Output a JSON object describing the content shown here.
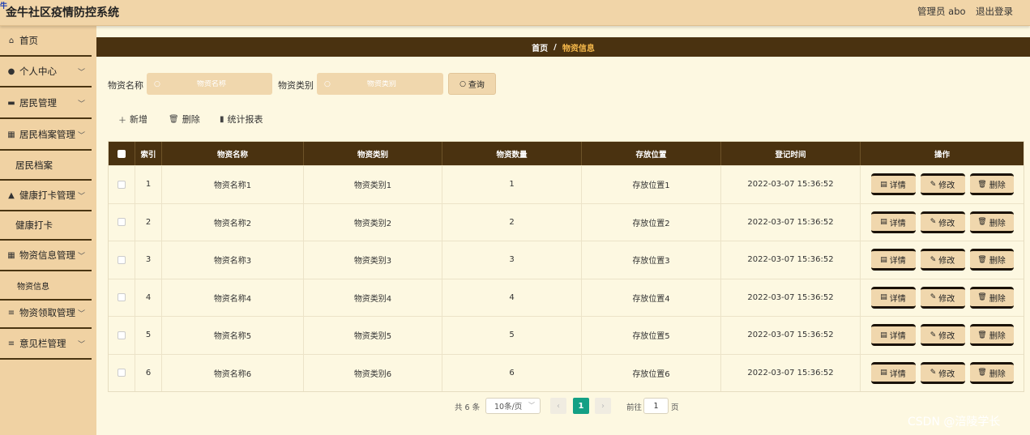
{
  "header": {
    "logo": "牛",
    "title": "金牛社区疫情防控系统",
    "user": "管理员 abo",
    "logout": "退出登录"
  },
  "sidebar": {
    "items": [
      {
        "label": "首页",
        "icon": "home-icon"
      },
      {
        "label": "个人中心",
        "icon": "user-icon"
      },
      {
        "label": "居民管理",
        "icon": "briefcase-icon"
      },
      {
        "label": "居民档案管理",
        "icon": "grid-icon"
      },
      {
        "label": "居民档案",
        "icon": ""
      },
      {
        "label": "健康打卡管理",
        "icon": "thumbs-up-icon"
      },
      {
        "label": "健康打卡",
        "icon": ""
      },
      {
        "label": "物资信息管理",
        "icon": "grid-icon"
      },
      {
        "label": "物资信息",
        "icon": ""
      },
      {
        "label": "物资领取管理",
        "icon": "list-icon"
      },
      {
        "label": "意见栏管理",
        "icon": "list-icon"
      }
    ]
  },
  "breadcrumb": {
    "home": "首页",
    "separator": "/",
    "current": "物资信息"
  },
  "search": {
    "name_label": "物资名称",
    "name_placeholder": "物资名称",
    "type_label": "物资类别",
    "type_placeholder": "物资类别",
    "query_button": "查询"
  },
  "actions": {
    "add": "新增",
    "delete": "删除",
    "report": "统计报表"
  },
  "table": {
    "columns": [
      "索引",
      "物资名称",
      "物资类别",
      "物资数量",
      "存放位置",
      "登记时间",
      "操作"
    ],
    "rows": [
      {
        "index": "1",
        "name": "物资名称1",
        "type": "物资类别1",
        "quantity": "1",
        "location": "存放位置1",
        "time": "2022-03-07 15:36:52"
      },
      {
        "index": "2",
        "name": "物资名称2",
        "type": "物资类别2",
        "quantity": "2",
        "location": "存放位置2",
        "time": "2022-03-07 15:36:52"
      },
      {
        "index": "3",
        "name": "物资名称3",
        "type": "物资类别3",
        "quantity": "3",
        "location": "存放位置3",
        "time": "2022-03-07 15:36:52"
      },
      {
        "index": "4",
        "name": "物资名称4",
        "type": "物资类别4",
        "quantity": "4",
        "location": "存放位置4",
        "time": "2022-03-07 15:36:52"
      },
      {
        "index": "5",
        "name": "物资名称5",
        "type": "物资类别5",
        "quantity": "5",
        "location": "存放位置5",
        "time": "2022-03-07 15:36:52"
      },
      {
        "index": "6",
        "name": "物资名称6",
        "type": "物资类别6",
        "quantity": "6",
        "location": "存放位置6",
        "time": "2022-03-07 15:36:52"
      }
    ],
    "ops": {
      "detail": "详情",
      "edit": "修改",
      "delete": "删除"
    }
  },
  "pagination": {
    "total": "共 6 条",
    "page_size": "10条/页",
    "current": "1",
    "goto_label": "前往",
    "goto_value": "1",
    "page_suffix": "页"
  },
  "watermark": "CSDN @涪陵学长",
  "colors": {
    "header_bg": "#f1d5a8",
    "sidebar_bg": "#f0d2a3",
    "dark_brown": "#4a3210",
    "content_bg": "#fdf8e1",
    "accent_orange": "#f5b84a",
    "pager_active": "#14a085"
  }
}
